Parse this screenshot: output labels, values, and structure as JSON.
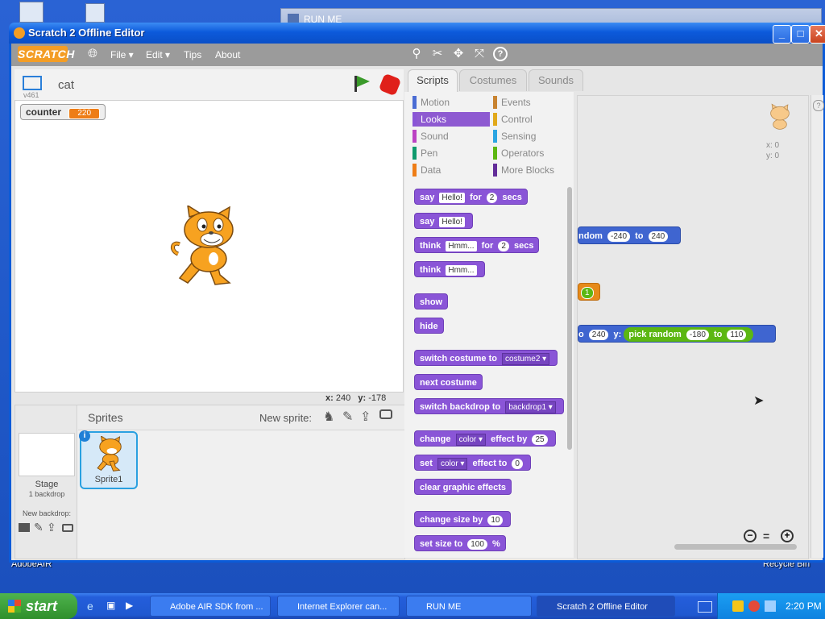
{
  "desktop": {
    "left_label": "AdobeAIR",
    "right_label": "Recycle Bin"
  },
  "back_window": {
    "title": "RUN ME"
  },
  "window": {
    "title": "Scratch 2 Offline Editor",
    "menus": [
      "File",
      "Edit",
      "Tips",
      "About"
    ],
    "logo": "SCRATCH"
  },
  "stage": {
    "version": "v461",
    "sprite_name": "cat",
    "monitor_label": "counter",
    "monitor_value": "220",
    "x_label": "x:",
    "x_value": "240",
    "y_label": "y:",
    "y_value": "-178"
  },
  "sprites_pane": {
    "title": "Sprites",
    "new_sprite_label": "New sprite:",
    "stage_label": "Stage",
    "stage_sub": "1 backdrop",
    "new_backdrop_label": "New backdrop:",
    "sprite1_label": "Sprite1"
  },
  "tabs": [
    "Scripts",
    "Costumes",
    "Sounds"
  ],
  "categories": {
    "left": [
      "Motion",
      "Looks",
      "Sound",
      "Pen",
      "Data"
    ],
    "right": [
      "Events",
      "Control",
      "Sensing",
      "Operators",
      "More Blocks"
    ],
    "selected": "Looks",
    "colors": {
      "Motion": "#4a6cd4",
      "Looks": "#8a55d7",
      "Sound": "#bb42c3",
      "Pen": "#0e9a6c",
      "Data": "#ee7d16",
      "Events": "#c88330",
      "Control": "#e1a91a",
      "Sensing": "#2ca5e2",
      "Operators": "#5cb712",
      "More Blocks": "#632d99"
    }
  },
  "palette_blocks": [
    {
      "id": "say-for",
      "parts": [
        "say",
        {
          "slot": "Hello!"
        },
        "for",
        {
          "num": "2"
        },
        "secs"
      ]
    },
    {
      "id": "say",
      "parts": [
        "say",
        {
          "slot": "Hello!"
        }
      ]
    },
    {
      "id": "think-for",
      "parts": [
        "think",
        {
          "slot": "Hmm..."
        },
        "for",
        {
          "num": "2"
        },
        "secs"
      ]
    },
    {
      "id": "think",
      "parts": [
        "think",
        {
          "slot": "Hmm..."
        }
      ]
    },
    {
      "id": "show",
      "parts": [
        "show"
      ]
    },
    {
      "id": "hide",
      "parts": [
        "hide"
      ]
    },
    {
      "id": "switch-costume",
      "parts": [
        "switch costume to",
        {
          "drop": "costume2"
        }
      ]
    },
    {
      "id": "next-costume",
      "parts": [
        "next costume"
      ]
    },
    {
      "id": "switch-backdrop",
      "parts": [
        "switch backdrop to",
        {
          "drop": "backdrop1"
        }
      ]
    },
    {
      "id": "change-effect",
      "parts": [
        "change",
        {
          "drop": "color"
        },
        "effect by",
        {
          "num": "25"
        }
      ]
    },
    {
      "id": "set-effect",
      "parts": [
        "set",
        {
          "drop": "color"
        },
        "effect to",
        {
          "num": "0"
        }
      ]
    },
    {
      "id": "clear-effects",
      "parts": [
        "clear graphic effects"
      ]
    },
    {
      "id": "change-size",
      "parts": [
        "change size by",
        {
          "num": "10"
        }
      ]
    },
    {
      "id": "set-size",
      "parts": [
        "set size to",
        {
          "num": "100"
        },
        "%"
      ]
    }
  ],
  "script_area": {
    "sprite_x": "x: 0",
    "sprite_y": "y: 0",
    "block1": {
      "text1": "ndom",
      "n1": "-240",
      "text2": "to",
      "n2": "240"
    },
    "block2": {
      "n": "1"
    },
    "block3": {
      "text1": "o",
      "n1": "240",
      "text2": "y:",
      "text3": "pick random",
      "n2": "-180",
      "text4": "to",
      "n3": "110"
    }
  },
  "taskbar": {
    "start": "start",
    "tasks": [
      "Adobe AIR SDK from ...",
      "Internet Explorer can...",
      "RUN ME",
      "Scratch 2 Offline Editor"
    ],
    "clock": "2:20 PM"
  }
}
